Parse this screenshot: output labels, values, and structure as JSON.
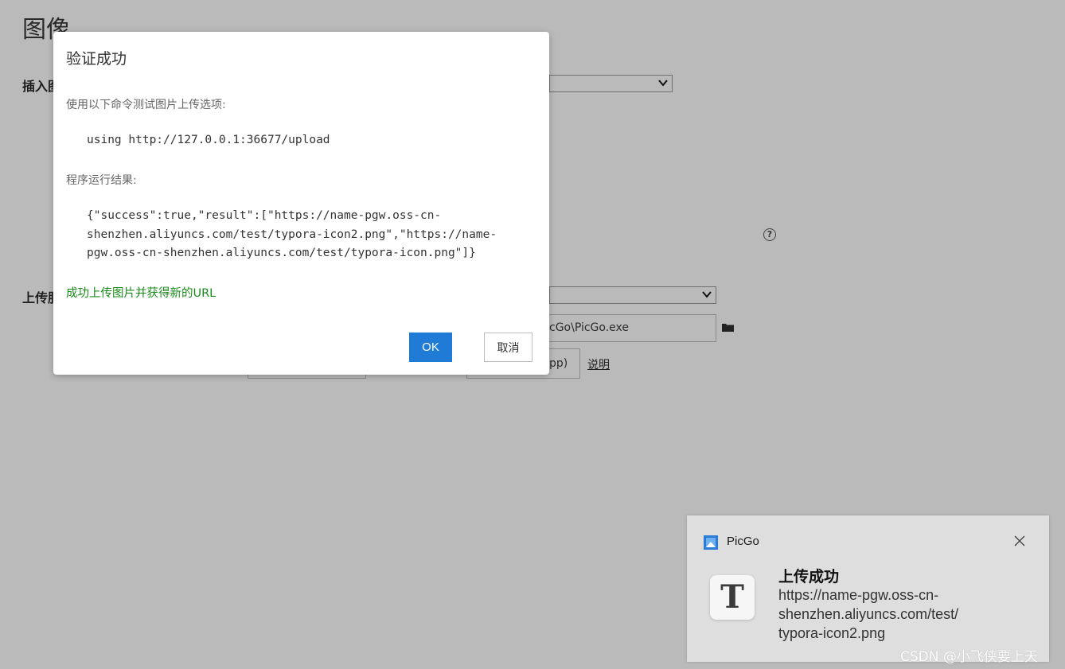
{
  "page": {
    "title": "图像",
    "insert_label": "插入图",
    "upload_label": "上传服",
    "picgo_path": "cGo\\PicGo.exe",
    "app_label_partial": "pp)",
    "explain_link": "说明"
  },
  "dialog": {
    "title": "验证成功",
    "intro": "使用以下命令测试图片上传选项:",
    "command": "using http://127.0.0.1:36677/upload",
    "result_label": "程序运行结果:",
    "result_lines": [
      "{\"success\":true,\"result\":[\"https://name-pgw.oss-cn-",
      "shenzhen.aliyuncs.com/test/typora-icon2.png\",\"https://name-",
      "pgw.oss-cn-shenzhen.aliyuncs.com/test/typora-icon.png\"]}"
    ],
    "success_message": "成功上传图片并获得新的URL",
    "ok_label": "OK",
    "cancel_label": "取消"
  },
  "toast": {
    "app_name": "PicGo",
    "title": "上传成功",
    "body_lines": [
      "https://name-pgw.oss-cn-",
      "shenzhen.aliyuncs.com/test/",
      "typora-icon2.png"
    ],
    "thumb_letter": "T"
  },
  "watermark": "CSDN @小飞侠要上天",
  "colors": {
    "accent": "#1f7bd6",
    "success": "#1a8a1a",
    "overlay": "#bababa"
  }
}
